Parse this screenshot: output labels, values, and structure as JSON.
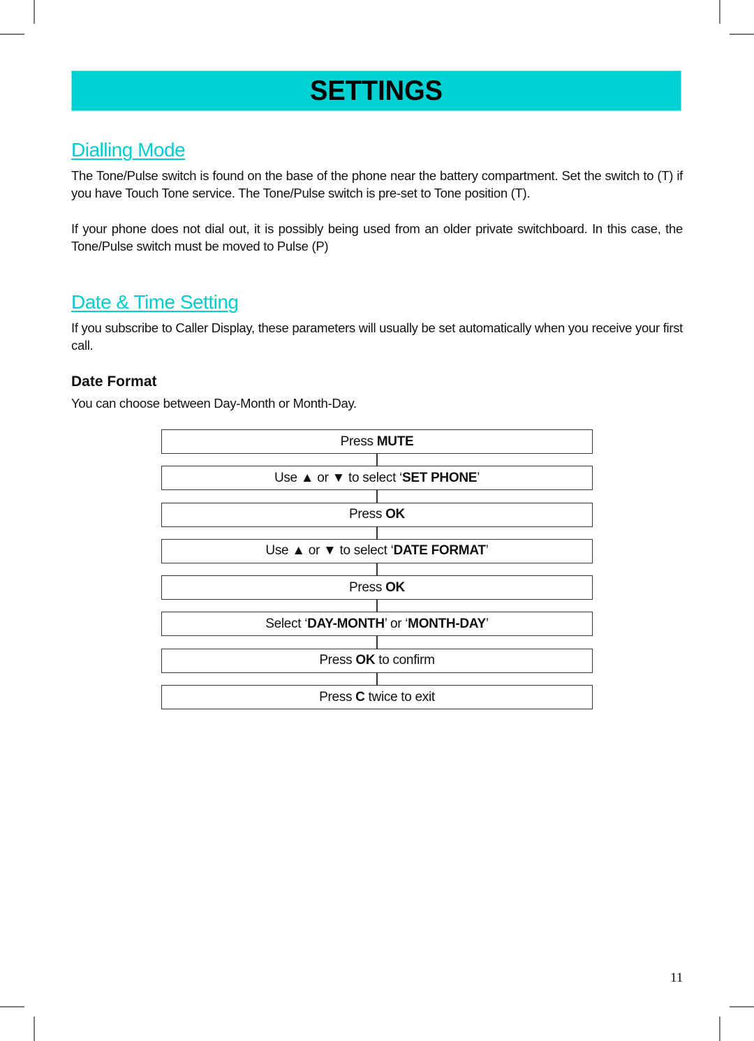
{
  "banner": {
    "title": "SETTINGS",
    "color": "#00d2d3"
  },
  "sections": {
    "dialling_mode": {
      "heading": "Dialling Mode",
      "paragraphs": [
        "The Tone/Pulse switch is found on the base of the phone near the battery compartment.  Set the switch to (T) if you have Touch Tone service.  The Tone/Pulse switch is pre-set to Tone position (T).",
        "If your phone does not dial out, it is possibly being used from an older private switchboard. In this case, the Tone/Pulse switch must be moved to Pulse (P)"
      ]
    },
    "date_time": {
      "heading": "Date & Time Setting",
      "paragraph": "If you subscribe to Caller Display, these parameters will usually be set automatically when you receive your first call.",
      "subheading": "Date Format",
      "intro": "You can choose between Day-Month or Month-Day."
    }
  },
  "flowchart": {
    "steps": [
      {
        "parts": [
          {
            "text": "Press ",
            "bold": false
          },
          {
            "text": "MUTE",
            "bold": true
          }
        ]
      },
      {
        "parts": [
          {
            "text": "Use ▲ or ▼ to select ‘",
            "bold": false
          },
          {
            "text": "SET PHONE",
            "bold": true
          },
          {
            "text": "’",
            "bold": false
          }
        ]
      },
      {
        "parts": [
          {
            "text": "Press ",
            "bold": false
          },
          {
            "text": "OK",
            "bold": true
          }
        ]
      },
      {
        "parts": [
          {
            "text": "Use ▲ or ▼ to select ‘",
            "bold": false
          },
          {
            "text": "DATE FORMAT",
            "bold": true
          },
          {
            "text": "’",
            "bold": false
          }
        ]
      },
      {
        "parts": [
          {
            "text": "Press ",
            "bold": false
          },
          {
            "text": "OK",
            "bold": true
          }
        ]
      },
      {
        "parts": [
          {
            "text": "Select ‘",
            "bold": false
          },
          {
            "text": "DAY-MONTH",
            "bold": true
          },
          {
            "text": "’ or ‘",
            "bold": false
          },
          {
            "text": "MONTH-DAY",
            "bold": true
          },
          {
            "text": "’",
            "bold": false
          }
        ]
      },
      {
        "parts": [
          {
            "text": "Press ",
            "bold": false
          },
          {
            "text": "OK",
            "bold": true
          },
          {
            "text": " to confirm",
            "bold": false
          }
        ]
      },
      {
        "parts": [
          {
            "text": "Press ",
            "bold": false
          },
          {
            "text": "C",
            "bold": true
          },
          {
            "text": " twice to exit",
            "bold": false
          }
        ]
      }
    ]
  },
  "footer": {
    "page_number": "11"
  }
}
